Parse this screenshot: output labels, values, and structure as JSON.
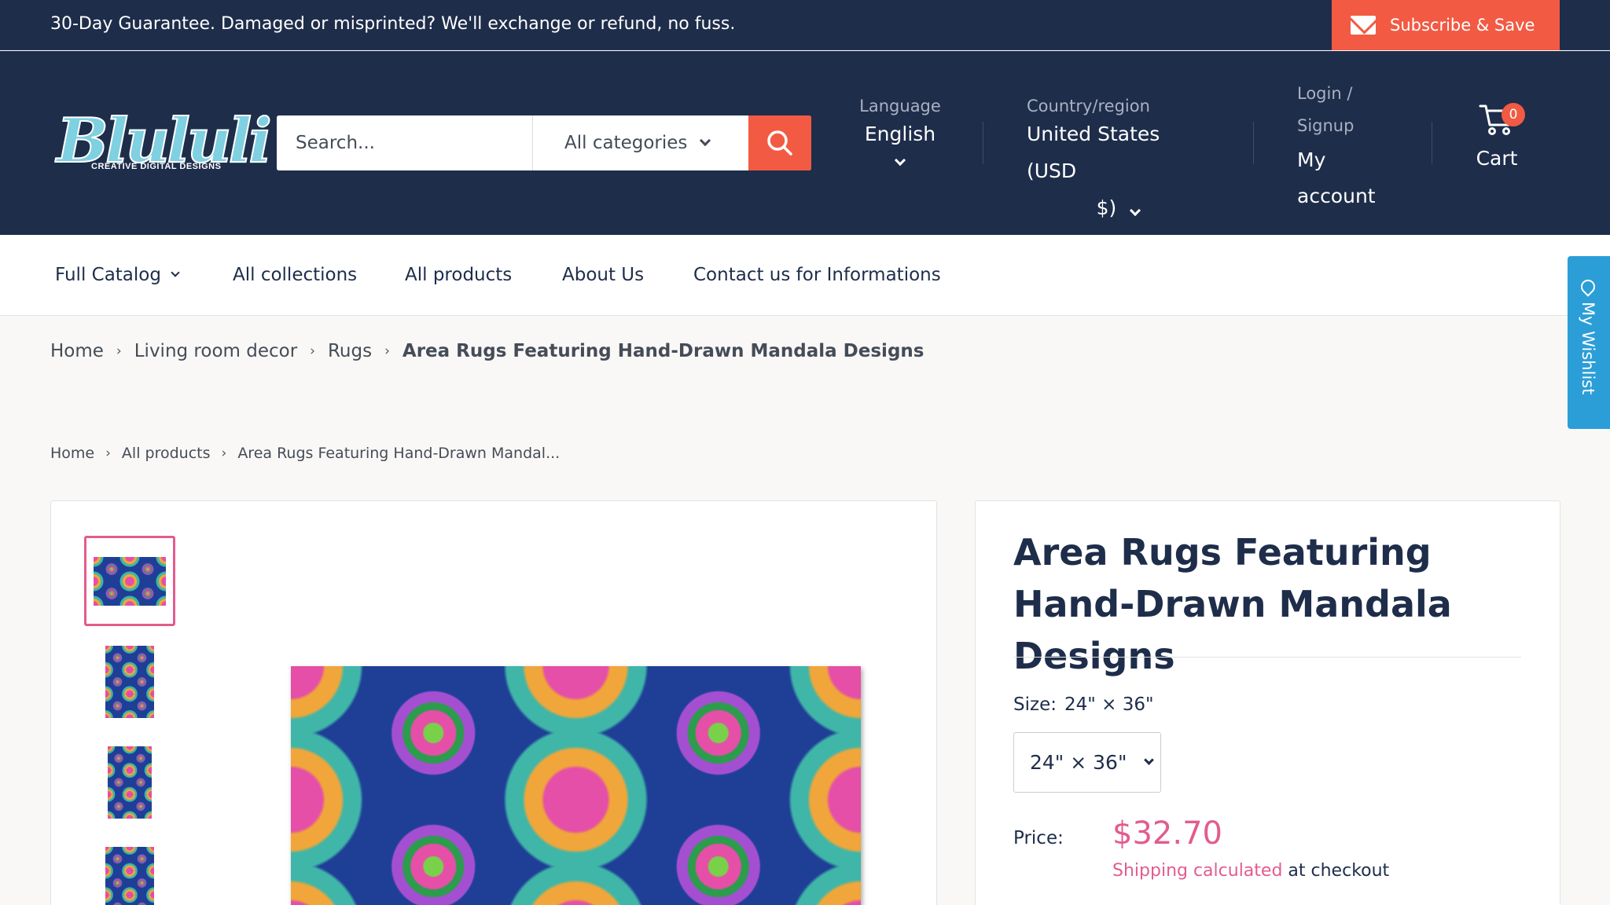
{
  "announcement": {
    "text": "30-Day Guarantee. Damaged or misprinted? We'll exchange or refund, no fuss.",
    "subscribe_label": "Subscribe & Save"
  },
  "header": {
    "logo": {
      "main": "Blululi",
      "sub": "CREATIVE DIGITAL DESIGNS"
    },
    "search": {
      "placeholder": "Search...",
      "category": "All categories"
    },
    "language": {
      "label": "Language",
      "value": "English"
    },
    "country": {
      "label": "Country/region",
      "value_line1": "United States (USD",
      "value_line2": "$)"
    },
    "account": {
      "login": "Login /",
      "signup": "Signup",
      "my": "My",
      "account": "account"
    },
    "cart": {
      "label": "Cart",
      "count": "0"
    }
  },
  "nav": {
    "items": [
      {
        "label": "Full Catalog",
        "has_dropdown": true
      },
      {
        "label": "All collections"
      },
      {
        "label": "All products"
      },
      {
        "label": "About Us"
      },
      {
        "label": "Contact us for Informations"
      }
    ]
  },
  "wishlist": {
    "label": "My Wishlist"
  },
  "breadcrumb_primary": [
    "Home",
    "Living room decor",
    "Rugs",
    "Area Rugs Featuring Hand-Drawn Mandala Designs"
  ],
  "breadcrumb_secondary": [
    "Home",
    "All products",
    "Area Rugs Featuring Hand-Drawn Mandal..."
  ],
  "product": {
    "title": "Area Rugs Featuring Hand-Drawn Mandala Designs",
    "size_label": "Size:",
    "size_value": "24\" × 36\"",
    "size_select_value": "24\" × 36\"",
    "price_label": "Price:",
    "price": "$32.70",
    "shipping_link": "Shipping calculated",
    "shipping_suffix": "at checkout"
  },
  "colors": {
    "navy": "#1e2d4a",
    "accent_orange": "#f25a43",
    "accent_pink": "#e25c8e",
    "wishlist_blue": "#2b9ed8"
  }
}
